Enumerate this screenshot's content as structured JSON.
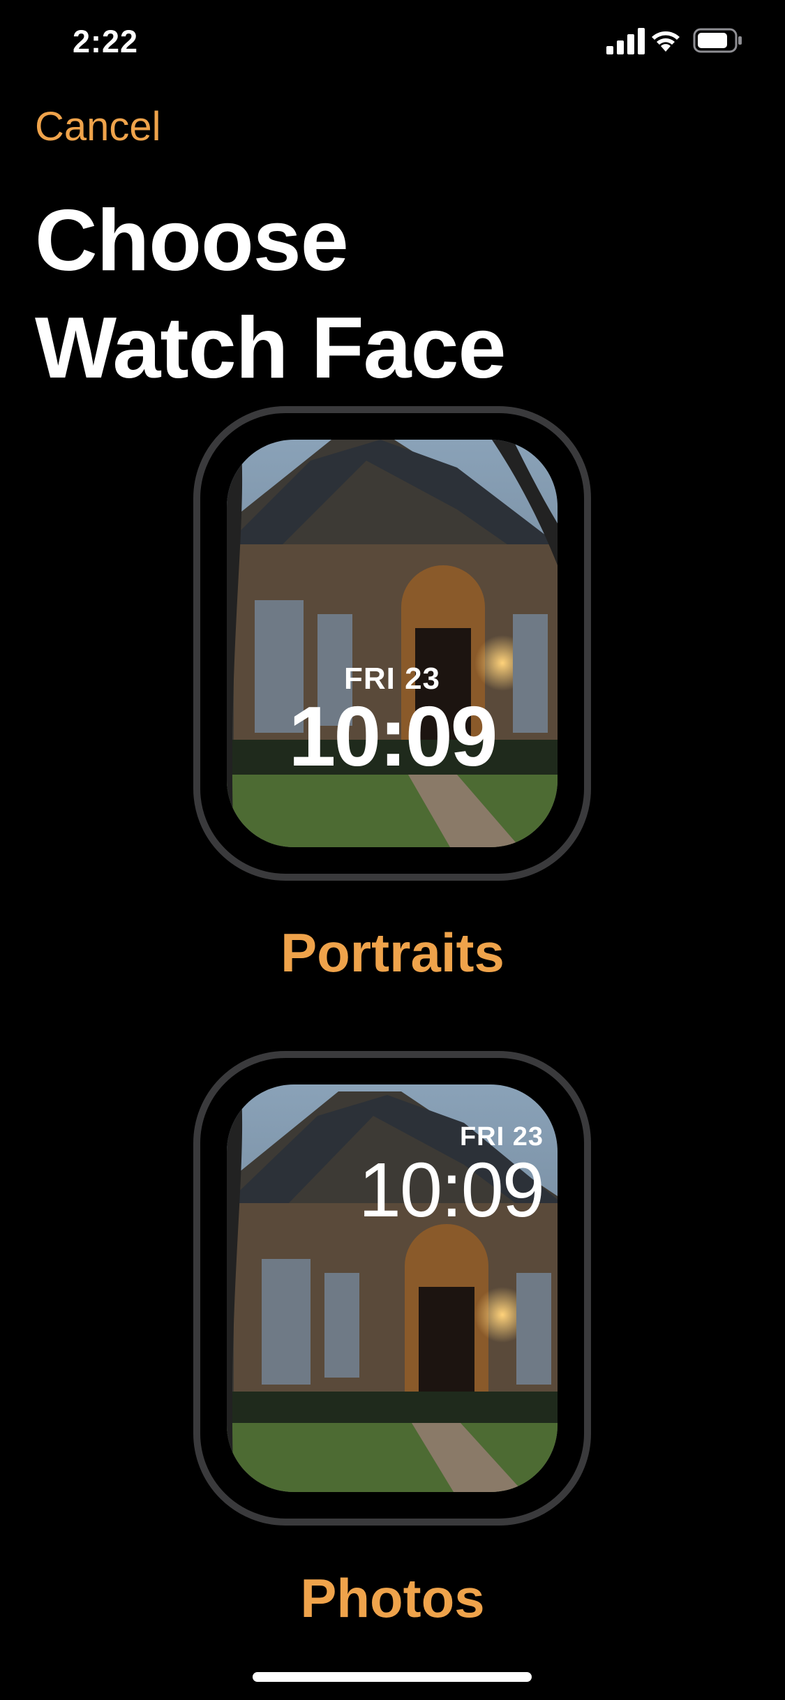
{
  "status": {
    "time": "2:22"
  },
  "nav": {
    "cancel_label": "Cancel"
  },
  "title": {
    "line1": "Choose",
    "line2": "Watch Face"
  },
  "faces": [
    {
      "label": "Portraits",
      "date": "FRI 23",
      "time": "10:09"
    },
    {
      "label": "Photos",
      "date": "FRI 23",
      "time": "10:09"
    }
  ],
  "colors": {
    "accent": "#EFA34B",
    "background": "#000000",
    "bezel": "#3a3a3c"
  },
  "icons": [
    "cellular-signal-icon",
    "wifi-icon",
    "battery-icon"
  ]
}
